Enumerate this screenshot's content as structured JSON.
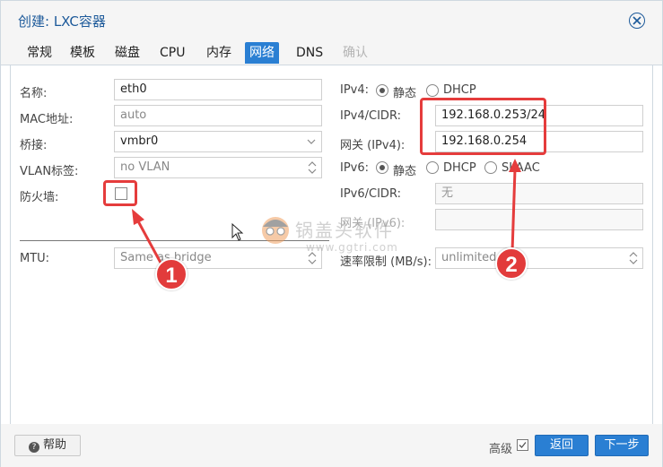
{
  "window": {
    "title": "创建: LXC容器"
  },
  "tabs": [
    {
      "label": "常规",
      "state": "normal"
    },
    {
      "label": "模板",
      "state": "normal"
    },
    {
      "label": "磁盘",
      "state": "normal"
    },
    {
      "label": "CPU",
      "state": "normal"
    },
    {
      "label": "内存",
      "state": "normal"
    },
    {
      "label": "网络",
      "state": "active"
    },
    {
      "label": "DNS",
      "state": "normal"
    },
    {
      "label": "确认",
      "state": "disabled"
    }
  ],
  "left": {
    "name_label": "名称:",
    "name_value": "eth0",
    "mac_label": "MAC地址:",
    "mac_placeholder": "auto",
    "bridge_label": "桥接:",
    "bridge_value": "vmbr0",
    "vlan_label": "VLAN标签:",
    "vlan_placeholder": "no VLAN",
    "firewall_label": "防火墙:",
    "firewall_checked": false,
    "mtu_label": "MTU:",
    "mtu_placeholder": "Same as bridge"
  },
  "right": {
    "ipv4_label": "IPv4:",
    "ipv4_static": "静态",
    "ipv4_dhcp": "DHCP",
    "ipv4_mode": "static",
    "ipv4cidr_label": "IPv4/CIDR:",
    "ipv4cidr_value": "192.168.0.253/24",
    "gw4_label": "网关 (IPv4):",
    "gw4_value": "192.168.0.254",
    "ipv6_label": "IPv6:",
    "ipv6_static": "静态",
    "ipv6_dhcp": "DHCP",
    "ipv6_slaac": "SLAAC",
    "ipv6_mode": "static",
    "ipv6cidr_label": "IPv6/CIDR:",
    "ipv6cidr_placeholder": "无",
    "gw6_label": "网关 (IPv6):",
    "rate_label": "速率限制 (MB/s):",
    "rate_placeholder": "unlimited"
  },
  "annotations": {
    "badge1": "1",
    "badge2": "2",
    "accent_color": "#e53c3c"
  },
  "watermark": {
    "text": "锅盖头软件",
    "url": "www.ggtri.com"
  },
  "footer": {
    "help_label": "帮助",
    "advanced_label": "高级",
    "advanced_checked": true,
    "back_label": "返回",
    "next_label": "下一步"
  },
  "colors": {
    "primary": "#2a7fd3",
    "title": "#1d5a9a"
  }
}
